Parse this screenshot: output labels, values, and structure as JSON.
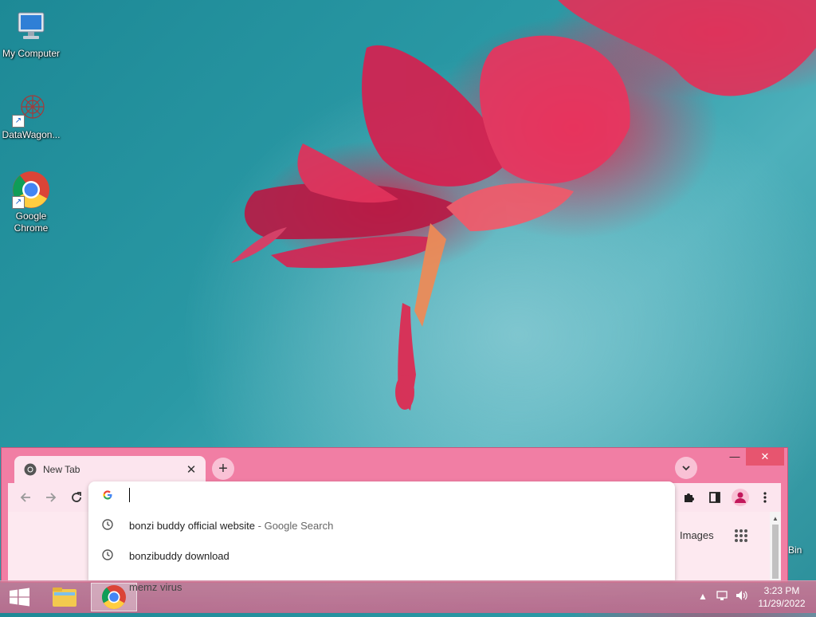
{
  "desktop": {
    "icons": [
      {
        "label": "My Computer"
      },
      {
        "label": "DataWagon..."
      },
      {
        "label": "Google Chrome"
      }
    ],
    "partial_label": "Bin"
  },
  "browser": {
    "tab": {
      "title": "New Tab",
      "favicon": "chrome-favicon-icon",
      "close_icon": "close-icon"
    },
    "new_tab_icon": "plus-icon",
    "tab_search_icon": "chevron-down-icon",
    "window_controls": {
      "minimize": "—",
      "maximize": "☐",
      "close": "✕"
    },
    "toolbar": {
      "back_icon": "arrow-left-icon",
      "forward_icon": "arrow-right-icon",
      "reload_icon": "reload-icon",
      "extensions_icon": "puzzle-icon",
      "sidepanel_icon": "side-panel-icon",
      "profile_icon": "profile-icon",
      "menu_icon": "kebab-menu-icon"
    },
    "omnibox": {
      "value": "",
      "suggestions": [
        {
          "text": "bonzi buddy official website",
          "suffix": " - Google Search"
        },
        {
          "text": "bonzibuddy download",
          "suffix": ""
        }
      ]
    },
    "content": {
      "images_link": "Images",
      "behind_text": "memz virus"
    }
  },
  "taskbar": {
    "time": "3:23 PM",
    "date": "11/29/2022",
    "tray_icons": [
      "chevron-up-icon",
      "network-icon",
      "volume-icon"
    ]
  },
  "colors": {
    "chrome_frame": "#f17ea4",
    "toolbar": "#fce5ee",
    "wallpaper_teal": "#2a99a5",
    "flower": "#e02850"
  }
}
